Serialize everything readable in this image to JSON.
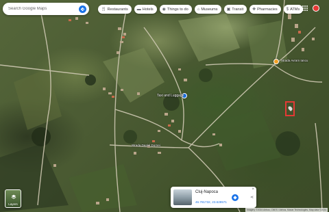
{
  "search": {
    "placeholder": "Search Google Maps"
  },
  "chips": [
    {
      "label": "Restaurants",
      "icon": "fork-knife-icon"
    },
    {
      "label": "Hotels",
      "icon": "bed-icon"
    },
    {
      "label": "Things to do",
      "icon": "camera-icon"
    },
    {
      "label": "Museums",
      "icon": "museum-icon"
    },
    {
      "label": "Transit",
      "icon": "bus-icon"
    },
    {
      "label": "Pharmacies",
      "icon": "pill-icon"
    },
    {
      "label": "ATMs",
      "icon": "atm-icon"
    }
  ],
  "map_labels": {
    "poi_taxi": "Taxi and Luggage",
    "street_bottom": "Strada Dealul Dornei",
    "street_top_right": "Strada Avram Iancu"
  },
  "layers": {
    "label": "Layers"
  },
  "card": {
    "title": "Cluj-Napoca",
    "coords": "46.781732, 23.628571"
  },
  "attribution": "Imagery ©2024 Airbus, CNES / Airbus, Maxar Technologies, Map data ©2024",
  "colors": {
    "accent": "#1a73e8",
    "marker": "#e53935"
  }
}
